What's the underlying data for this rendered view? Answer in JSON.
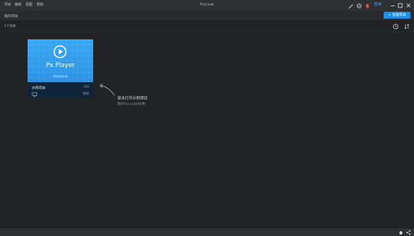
{
  "menu": [
    "项目",
    "编辑",
    "视图",
    "帮助"
  ],
  "app_title": "PxCook",
  "header": {
    "login_label": "登录"
  },
  "toolbar": {
    "create_label": "+ 创建项目"
  },
  "sidebar": {
    "section_label": "我的项目",
    "count_label": "1个项目"
  },
  "project": {
    "thumb_title": "Px Player",
    "thumb_sub": "Usemonic",
    "name": "示例项目",
    "platform": "iOS",
    "date": "刚刚",
    "colors": {
      "thumb_top": "#3aa7f2",
      "thumb_bottom": "#2b93e6",
      "card_footer": "#0f2438"
    }
  },
  "hint": {
    "title": "双击打开示例项目",
    "subtitle": "重新PxCook好好用!"
  },
  "colors": {
    "accent": "#1e8fe8",
    "background": "#222324",
    "titlebar": "#2f3031"
  }
}
